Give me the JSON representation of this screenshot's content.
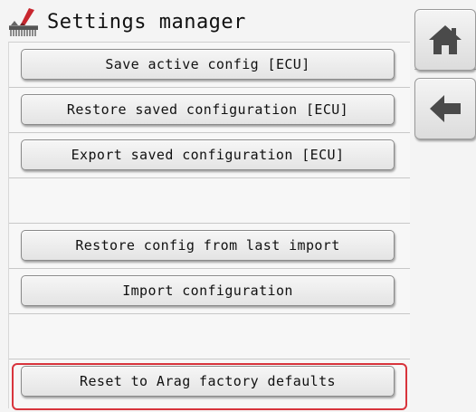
{
  "header": {
    "title": "Settings manager",
    "icon": "settings-brush-icon"
  },
  "buttons": {
    "save_active": "Save active config [ECU]",
    "restore_saved": "Restore saved configuration [ECU]",
    "export_saved": "Export saved configuration [ECU]",
    "restore_last_import": "Restore config from last import",
    "import_config": "Import configuration",
    "reset_factory": "Reset to Arag factory defaults"
  },
  "side_nav": {
    "home_icon": "home-icon",
    "back_icon": "back-arrow-icon"
  },
  "colors": {
    "highlight": "#d8343c",
    "icon_red": "#c8262e"
  }
}
